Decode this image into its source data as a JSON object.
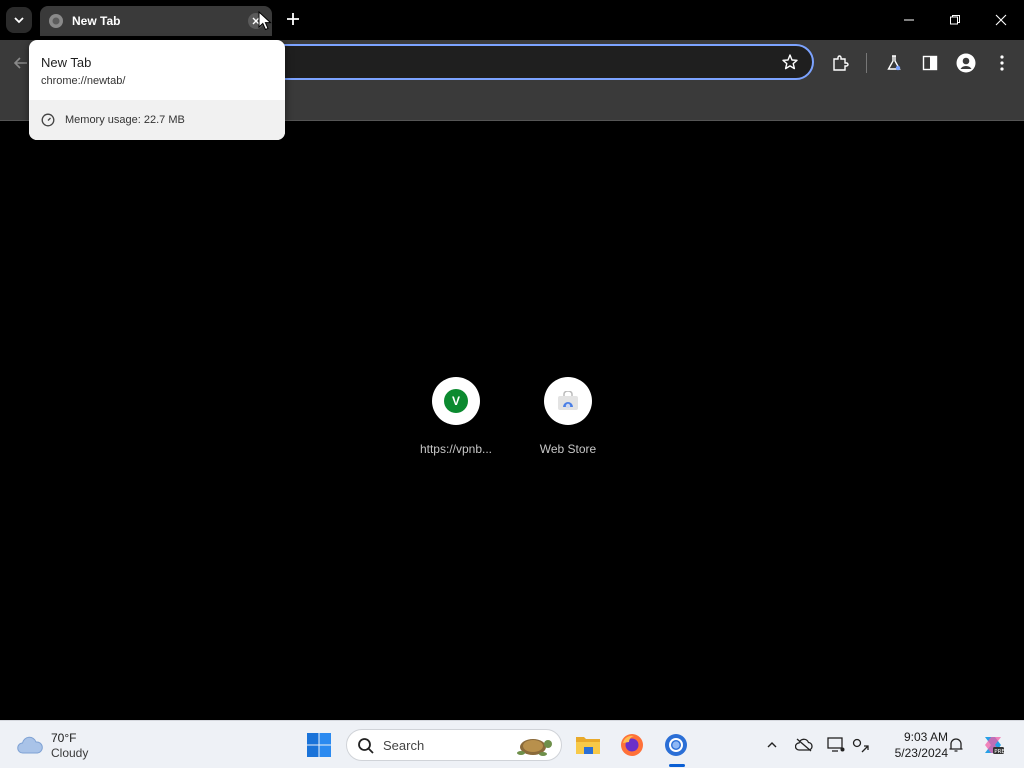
{
  "browser": {
    "tab": {
      "title": "New Tab"
    },
    "hover_card": {
      "title": "New Tab",
      "url": "chrome://newtab/",
      "memory": "Memory usage: 22.7 MB"
    },
    "accent_color": "#7ca3ff",
    "icons": {
      "tab_search": "chevron-down-icon",
      "new_tab": "plus-icon",
      "bookmark": "star-icon",
      "extensions": "puzzle-icon",
      "labs": "flask-icon",
      "side_panel": "side-panel-icon",
      "profile": "profile-icon",
      "menu": "kebab-menu-icon"
    }
  },
  "new_tab_page": {
    "shortcuts": [
      {
        "label": "https://vpnb...",
        "badge": "V",
        "badge_color": "#0b8a2f"
      },
      {
        "label": "Web Store"
      }
    ]
  },
  "taskbar": {
    "weather": {
      "temp": "70°F",
      "condition": "Cloudy"
    },
    "search": {
      "placeholder": "Search"
    },
    "clock": {
      "time": "9:03 AM",
      "date": "5/23/2024"
    }
  }
}
